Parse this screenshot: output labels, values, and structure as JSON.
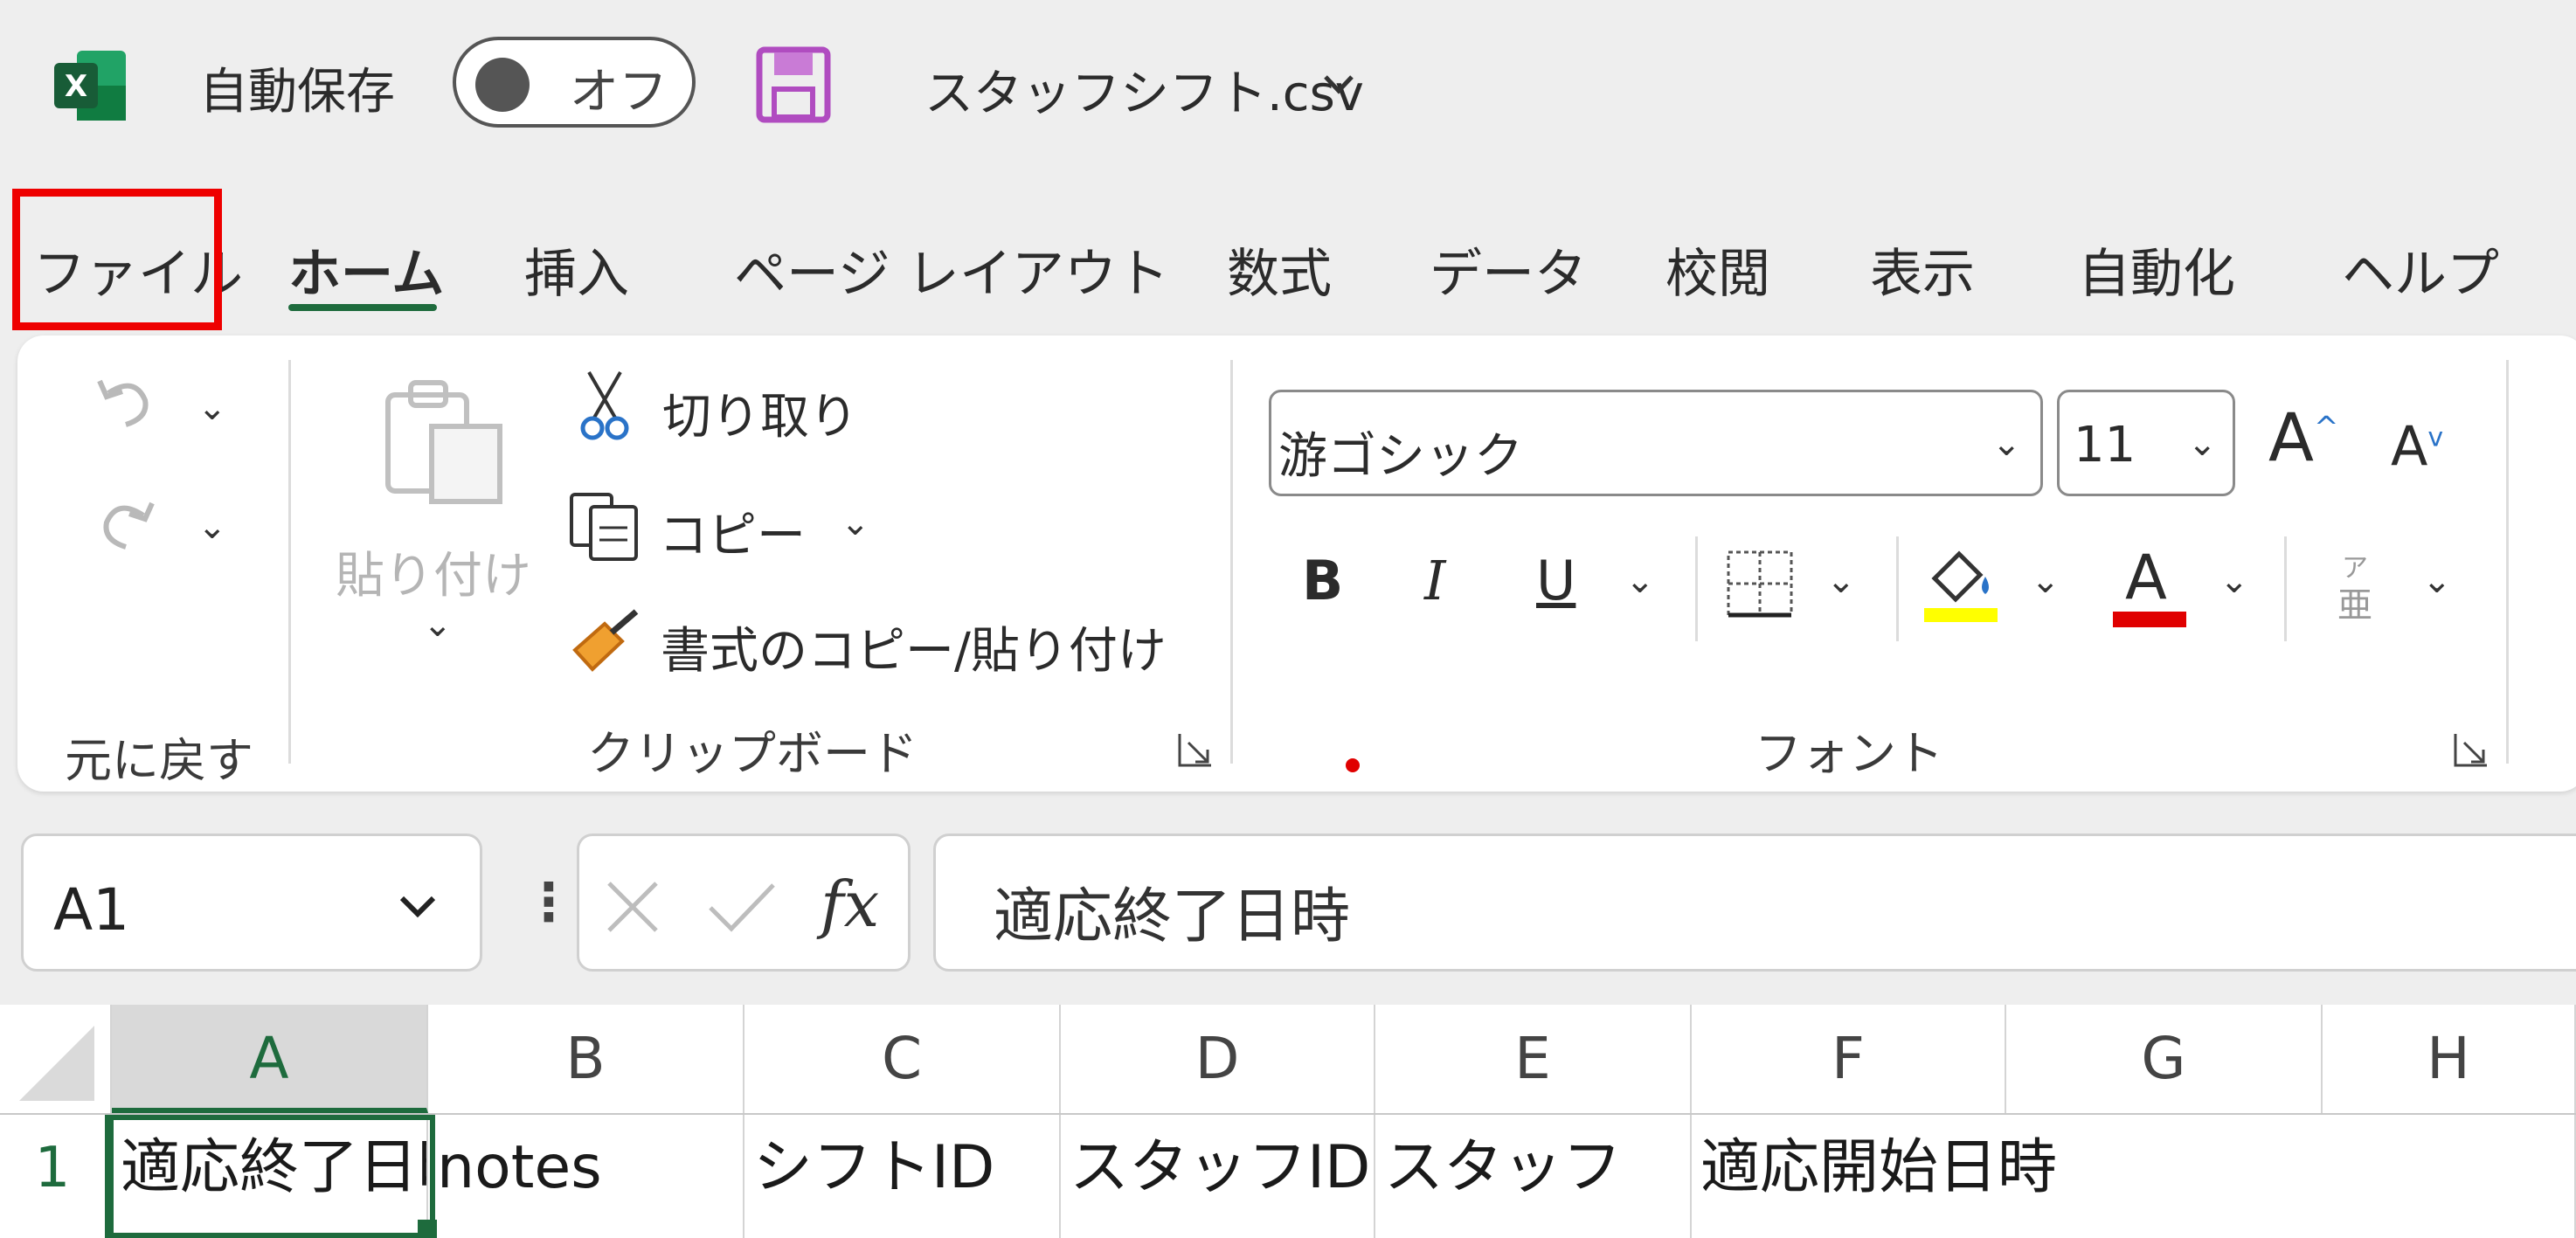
{
  "titlebar": {
    "autosave_label": "自動保存",
    "autosave_state": "オフ",
    "filename": "スタッフシフト.csv",
    "app_icon_letter": "X"
  },
  "tabs": [
    {
      "label": "ファイル"
    },
    {
      "label": "ホーム"
    },
    {
      "label": "挿入"
    },
    {
      "label": "ページ レイアウト"
    },
    {
      "label": "数式"
    },
    {
      "label": "データ"
    },
    {
      "label": "校閲"
    },
    {
      "label": "表示"
    },
    {
      "label": "自動化"
    },
    {
      "label": "ヘルプ"
    }
  ],
  "ribbon": {
    "undo_group": "元に戻す",
    "clipboard": {
      "paste": "貼り付け",
      "cut": "切り取り",
      "copy": "コピー",
      "format_painter": "書式のコピー/貼り付け",
      "group": "クリップボード"
    },
    "font": {
      "name": "游ゴシック",
      "size": "11",
      "grow": "A",
      "shrink": "A",
      "bold": "B",
      "italic": "I",
      "underline": "U",
      "font_color_letter": "A",
      "group": "フォント",
      "fill_color": "#ffff00",
      "text_color": "#e00000"
    }
  },
  "formula_bar": {
    "name_box": "A1",
    "fx": "fx",
    "content": "適応終了日時"
  },
  "sheet": {
    "columns": [
      "A",
      "B",
      "C",
      "D",
      "E",
      "F",
      "G",
      "H"
    ],
    "rows": [
      {
        "num": "1",
        "cells": [
          "適応終了日時",
          "notes",
          "シフトID",
          "スタッフID",
          "スタッフ",
          "適応開始日時",
          "",
          ""
        ]
      }
    ]
  },
  "colors": {
    "accent": "#1e6b3d",
    "highlight": "#ee0000"
  }
}
